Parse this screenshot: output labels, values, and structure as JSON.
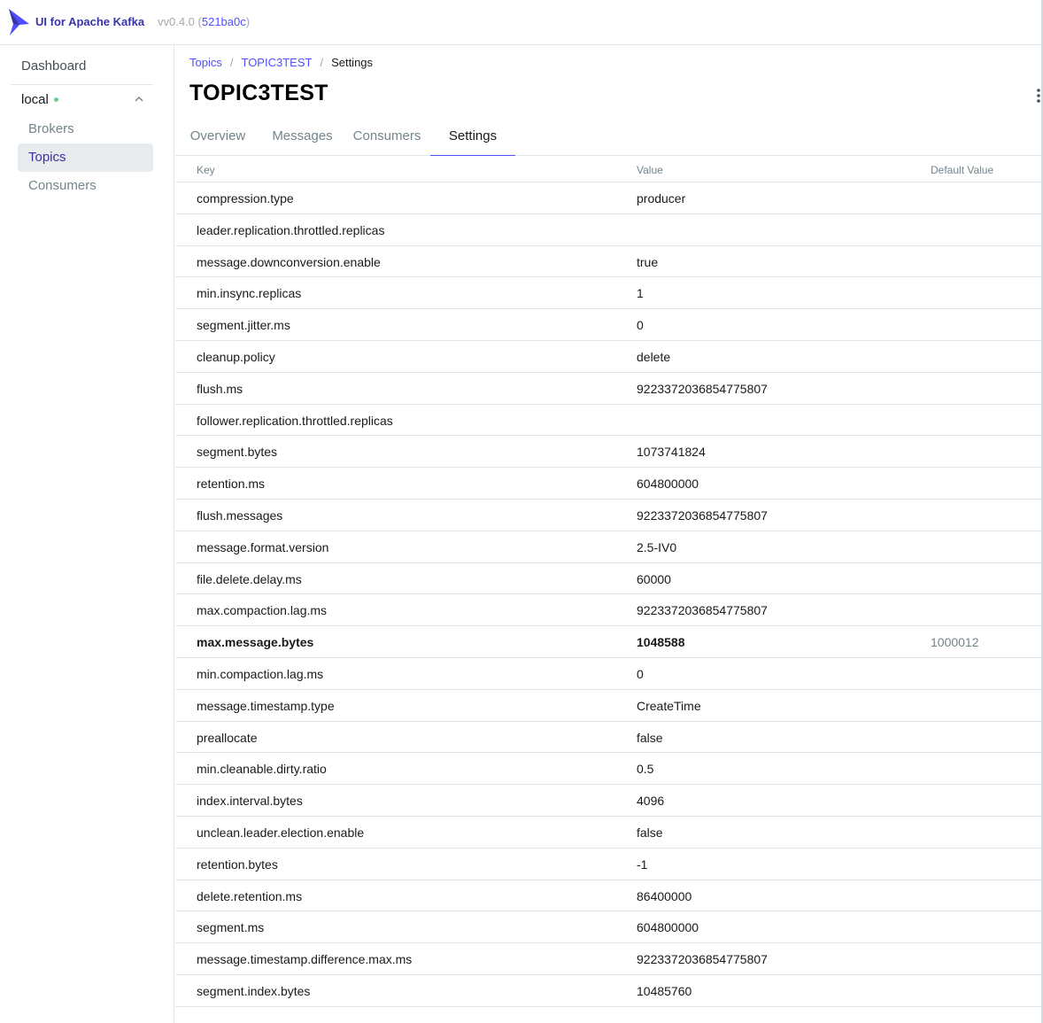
{
  "header": {
    "brand": "UI for Apache Kafka",
    "version_prefix": "vv0.4.0 (",
    "commit": "521ba0c",
    "version_suffix": ")"
  },
  "sidebar": {
    "dashboard": "Dashboard",
    "cluster": {
      "name": "local",
      "status_color": "#5cd685"
    },
    "items": [
      {
        "label": "Brokers",
        "active": false
      },
      {
        "label": "Topics",
        "active": true
      },
      {
        "label": "Consumers",
        "active": false
      }
    ]
  },
  "breadcrumb": {
    "root": "Topics",
    "topic": "TOPIC3TEST",
    "current": "Settings",
    "separator": "/"
  },
  "page": {
    "title": "TOPIC3TEST"
  },
  "tabs": [
    {
      "label": "Overview",
      "active": false
    },
    {
      "label": "Messages",
      "active": false
    },
    {
      "label": "Consumers",
      "active": false
    },
    {
      "label": "Settings",
      "active": true
    }
  ],
  "table": {
    "columns": {
      "key": "Key",
      "value": "Value",
      "default": "Default Value"
    },
    "rows": [
      {
        "key": "compression.type",
        "value": "producer",
        "default": ""
      },
      {
        "key": "leader.replication.throttled.replicas",
        "value": "",
        "default": ""
      },
      {
        "key": "message.downconversion.enable",
        "value": "true",
        "default": ""
      },
      {
        "key": "min.insync.replicas",
        "value": "1",
        "default": ""
      },
      {
        "key": "segment.jitter.ms",
        "value": "0",
        "default": ""
      },
      {
        "key": "cleanup.policy",
        "value": "delete",
        "default": ""
      },
      {
        "key": "flush.ms",
        "value": "9223372036854775807",
        "default": ""
      },
      {
        "key": "follower.replication.throttled.replicas",
        "value": "",
        "default": ""
      },
      {
        "key": "segment.bytes",
        "value": "1073741824",
        "default": ""
      },
      {
        "key": "retention.ms",
        "value": "604800000",
        "default": ""
      },
      {
        "key": "flush.messages",
        "value": "9223372036854775807",
        "default": ""
      },
      {
        "key": "message.format.version",
        "value": "2.5-IV0",
        "default": ""
      },
      {
        "key": "file.delete.delay.ms",
        "value": "60000",
        "default": ""
      },
      {
        "key": "max.compaction.lag.ms",
        "value": "9223372036854775807",
        "default": ""
      },
      {
        "key": "max.message.bytes",
        "value": "1048588",
        "default": "1000012",
        "highlight": true
      },
      {
        "key": "min.compaction.lag.ms",
        "value": "0",
        "default": ""
      },
      {
        "key": "message.timestamp.type",
        "value": "CreateTime",
        "default": ""
      },
      {
        "key": "preallocate",
        "value": "false",
        "default": ""
      },
      {
        "key": "min.cleanable.dirty.ratio",
        "value": "0.5",
        "default": ""
      },
      {
        "key": "index.interval.bytes",
        "value": "4096",
        "default": ""
      },
      {
        "key": "unclean.leader.election.enable",
        "value": "false",
        "default": ""
      },
      {
        "key": "retention.bytes",
        "value": "-1",
        "default": ""
      },
      {
        "key": "delete.retention.ms",
        "value": "86400000",
        "default": ""
      },
      {
        "key": "segment.ms",
        "value": "604800000",
        "default": ""
      },
      {
        "key": "message.timestamp.difference.max.ms",
        "value": "9223372036854775807",
        "default": ""
      },
      {
        "key": "segment.index.bytes",
        "value": "10485760",
        "default": ""
      }
    ]
  },
  "colors": {
    "brand": "#3a33a8",
    "link": "#4f4fff",
    "muted": "#73848c",
    "active_bg": "#e8ebed"
  }
}
